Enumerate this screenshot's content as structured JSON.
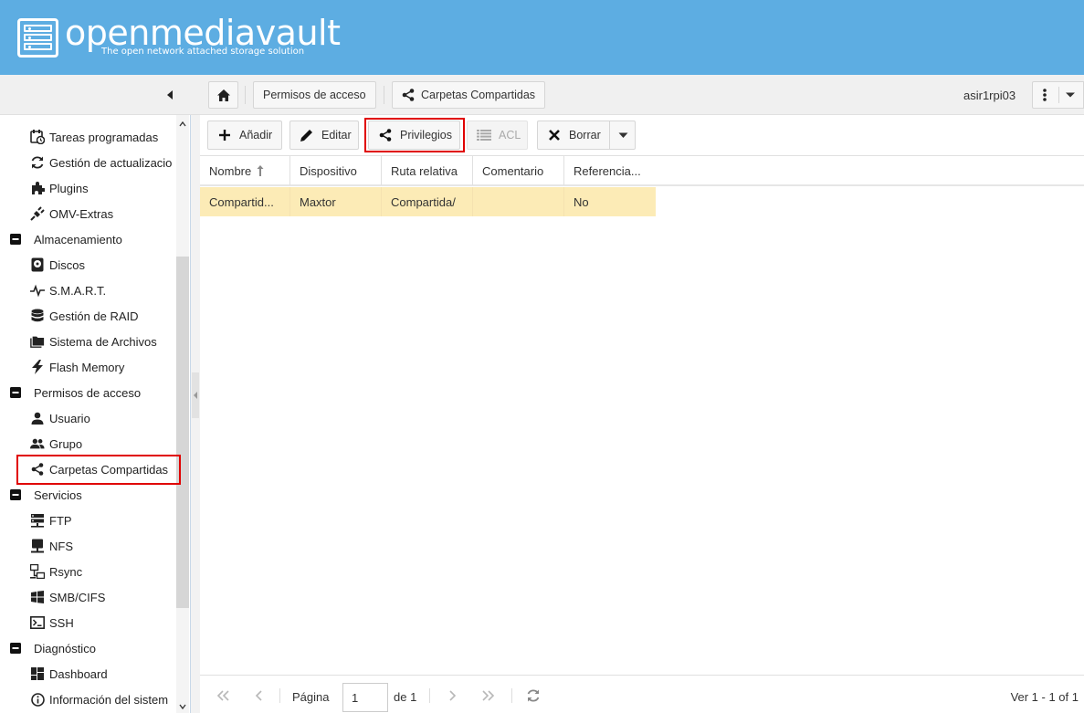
{
  "header": {
    "app_name": "openmediavault",
    "tagline": "The open network attached storage solution"
  },
  "breadcrumb": {
    "items": [
      "Permisos de acceso",
      "Carpetas Compartidas"
    ]
  },
  "topbar": {
    "hostname": "asir1rpi03"
  },
  "sidebar": {
    "items": [
      {
        "label": "Tareas programadas",
        "icon": "calendar-clock-icon"
      },
      {
        "label": "Gestión de actualizacio",
        "icon": "refresh-icon"
      },
      {
        "label": "Plugins",
        "icon": "puzzle-icon"
      },
      {
        "label": "OMV-Extras",
        "icon": "plug-icon"
      },
      {
        "label": "Almacenamiento",
        "icon": "minus-square-icon",
        "category": true
      },
      {
        "label": "Discos",
        "icon": "harddisk-icon"
      },
      {
        "label": "S.M.A.R.T.",
        "icon": "pulse-icon"
      },
      {
        "label": "Gestión de RAID",
        "icon": "database-icon"
      },
      {
        "label": "Sistema de Archivos",
        "icon": "folders-icon"
      },
      {
        "label": "Flash Memory",
        "icon": "flash-icon"
      },
      {
        "label": "Permisos de acceso",
        "icon": "minus-square-icon",
        "category": true
      },
      {
        "label": "Usuario",
        "icon": "user-icon"
      },
      {
        "label": "Grupo",
        "icon": "group-icon"
      },
      {
        "label": "Carpetas Compartidas",
        "icon": "share-icon"
      },
      {
        "label": "Servicios",
        "icon": "minus-square-icon",
        "category": true
      },
      {
        "label": "FTP",
        "icon": "server-icon"
      },
      {
        "label": "NFS",
        "icon": "nfs-icon"
      },
      {
        "label": "Rsync",
        "icon": "rsync-icon"
      },
      {
        "label": "SMB/CIFS",
        "icon": "windows-icon"
      },
      {
        "label": "SSH",
        "icon": "console-icon"
      },
      {
        "label": "Diagnóstico",
        "icon": "minus-square-icon",
        "category": true
      },
      {
        "label": "Dashboard",
        "icon": "dashboard-icon"
      },
      {
        "label": "Información del sistem",
        "icon": "info-icon"
      }
    ]
  },
  "actions": {
    "add": "Añadir",
    "edit": "Editar",
    "privileges": "Privilegios",
    "acl": "ACL",
    "delete": "Borrar"
  },
  "grid": {
    "columns": [
      "Nombre",
      "Dispositivo",
      "Ruta relativa",
      "Comentario",
      "Referencia..."
    ],
    "rows": [
      [
        "Compartid...",
        "Maxtor",
        "Compartida/",
        "",
        "No"
      ]
    ]
  },
  "pager": {
    "page_label": "Página",
    "page_value": "1",
    "of_label": "de 1",
    "summary": "Ver 1 - 1 of 1"
  },
  "colors": {
    "header_bg": "#5dade2",
    "selected_row": "#fcebb6",
    "highlight": "#e00000"
  }
}
